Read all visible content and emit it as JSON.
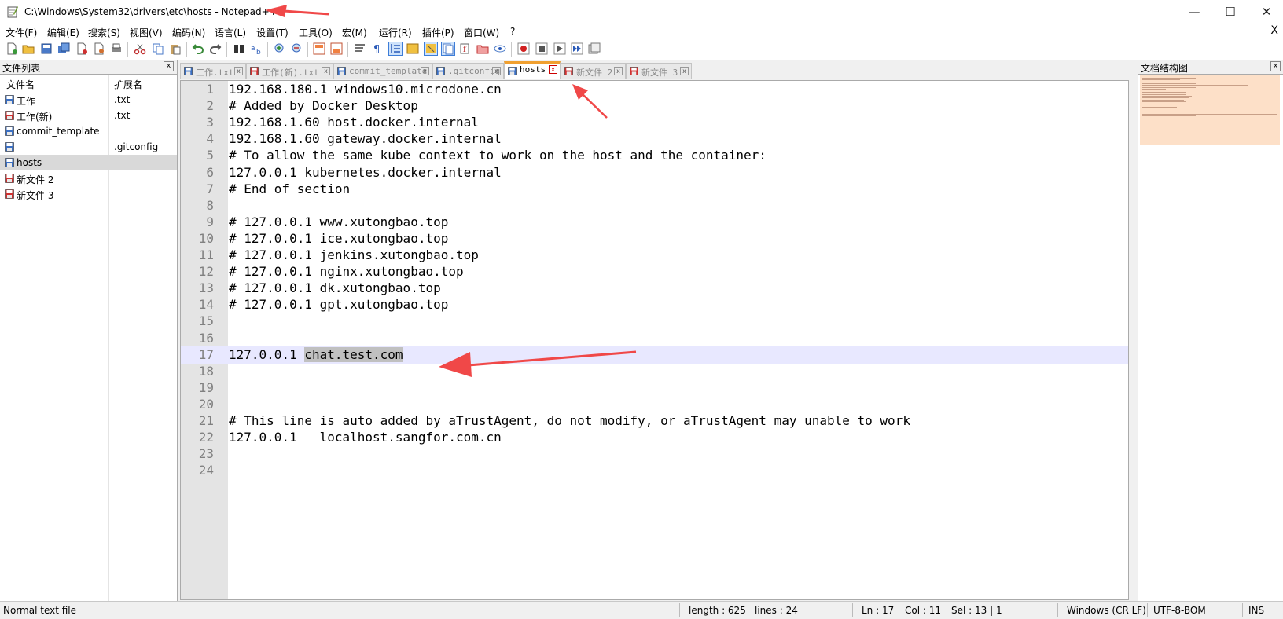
{
  "window": {
    "title": "C:\\Windows\\System32\\drivers\\etc\\hosts - Notepad++",
    "min_glyph": "—",
    "max_glyph": "☐",
    "close_glyph": "✕"
  },
  "menu": [
    "文件(F)",
    "编辑(E)",
    "搜索(S)",
    "视图(V)",
    "编码(N)",
    "语言(L)",
    "设置(T)",
    "工具(O)",
    "宏(M)",
    "运行(R)",
    "插件(P)",
    "窗口(W)",
    "?"
  ],
  "menu_close": "X",
  "file_list": {
    "title": "文件列表",
    "close": "x",
    "col_name": "文件名",
    "col_ext": "扩展名",
    "files": [
      {
        "name": "工作",
        "ext": ".txt",
        "state": "saved"
      },
      {
        "name": "工作(新)",
        "ext": ".txt",
        "state": "modified"
      },
      {
        "name": "commit_template",
        "ext": "",
        "state": "saved"
      },
      {
        "name": "",
        "ext": ".gitconfig",
        "state": "saved"
      },
      {
        "name": "hosts",
        "ext": "",
        "state": "saved",
        "selected": true
      },
      {
        "name": "新文件 2",
        "ext": "",
        "state": "modified"
      },
      {
        "name": "新文件 3",
        "ext": "",
        "state": "modified"
      }
    ]
  },
  "tabs": [
    {
      "label": "工作.txt",
      "state": "saved"
    },
    {
      "label": "工作(新).txt",
      "state": "modified"
    },
    {
      "label": "commit_template",
      "state": "saved"
    },
    {
      "label": ".gitconfig",
      "state": "saved"
    },
    {
      "label": "hosts",
      "state": "saved",
      "active": true
    },
    {
      "label": "新文件 2",
      "state": "modified"
    },
    {
      "label": "新文件 3",
      "state": "modified"
    }
  ],
  "tab_close": "x",
  "editor": {
    "current_line": 17,
    "selected_text": "chat.test.com",
    "lines": [
      "192.168.180.1 windows10.microdone.cn",
      "# Added by Docker Desktop",
      "192.168.1.60 host.docker.internal",
      "192.168.1.60 gateway.docker.internal",
      "# To allow the same kube context to work on the host and the container:",
      "127.0.0.1 kubernetes.docker.internal",
      "# End of section",
      "",
      "# 127.0.0.1 www.xutongbao.top",
      "# 127.0.0.1 ice.xutongbao.top",
      "# 127.0.0.1 jenkins.xutongbao.top",
      "# 127.0.0.1 nginx.xutongbao.top",
      "# 127.0.0.1 dk.xutongbao.top",
      "# 127.0.0.1 gpt.xutongbao.top",
      "",
      "",
      "127.0.0.1 chat.test.com",
      "",
      "",
      "",
      "# This line is auto added by aTrustAgent, do not modify, or aTrustAgent may unable to work",
      "127.0.0.1   localhost.sangfor.com.cn",
      "",
      ""
    ]
  },
  "doc_map": {
    "title": "文档结构图",
    "close": "x"
  },
  "status": {
    "type": "Normal text file",
    "length": "length : 625",
    "lines": "lines : 24",
    "ln": "Ln : 17",
    "col": "Col : 11",
    "sel": "Sel : 13 | 1",
    "eol": "Windows (CR LF)",
    "encoding": "UTF-8-BOM",
    "mode": "INS"
  },
  "colors": {
    "saved_icon": "#3a6fc4",
    "modified_icon": "#d03030",
    "active_tab_accent": "#f0a030",
    "current_line_bg": "#e8e8ff",
    "annotation_arrow": "#f04040"
  }
}
